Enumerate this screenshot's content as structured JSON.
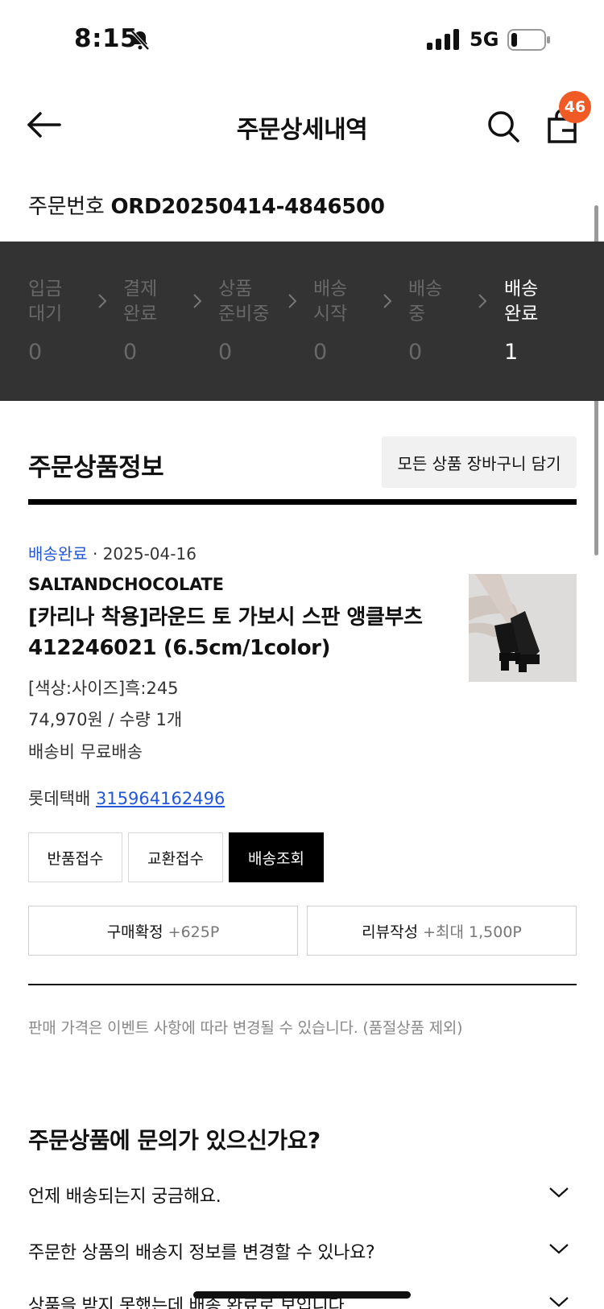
{
  "status_bar": {
    "time": "8:15",
    "network": "5G"
  },
  "header": {
    "title": "주문상세내역",
    "cart_badge": "46"
  },
  "order": {
    "label": "주문번호",
    "number": "ORD20250414-4846500"
  },
  "progress_steps": [
    {
      "label": "입금\n대기",
      "count": "0"
    },
    {
      "label": "결제\n완료",
      "count": "0"
    },
    {
      "label": "상품\n준비중",
      "count": "0"
    },
    {
      "label": "배송\n시작",
      "count": "0"
    },
    {
      "label": "배송\n중",
      "count": "0"
    },
    {
      "label": "배송\n완료",
      "count": "1"
    }
  ],
  "section": {
    "title": "주문상품정보",
    "cart_all_label": "모든 상품 장바구니 담기"
  },
  "product": {
    "status": "배송완료",
    "separator": "·",
    "date": "2025-04-16",
    "brand": "SALTANDCHOCOLATE",
    "name": "[카리나 착용]라운드 토 가보시 스판 앵클부츠 412246021 (6.5cm/1color)",
    "option": "[색상:사이즈]흑:245",
    "price_qty": "74,970원 / 수량 1개",
    "shipping": "배송비 무료배송",
    "courier": "롯데택배",
    "tracking": "315964162496"
  },
  "actions": {
    "return_label": "반품접수",
    "exchange_label": "교환접수",
    "track_label": "배송조회",
    "confirm_label": "구매확정",
    "confirm_points": "+625P",
    "review_label": "리뷰작성",
    "review_points": "+최대 1,500P"
  },
  "note": "판매 가격은 이벤트 사항에 따라 변경될 수 있습니다. (품절상품 제외)",
  "faq": {
    "title": "주문상품에 문의가 있으신가요?",
    "items": [
      "언제 배송되는지 궁금해요.",
      "주문한 상품의 배송지 정보를 변경할 수 있나요?",
      "상품을 받지 못했는데 배송 완료로 보입니다."
    ]
  },
  "colors": {
    "accent_blue": "#2457d6",
    "badge_orange": "#f05a24",
    "progress_bg": "#333333"
  }
}
